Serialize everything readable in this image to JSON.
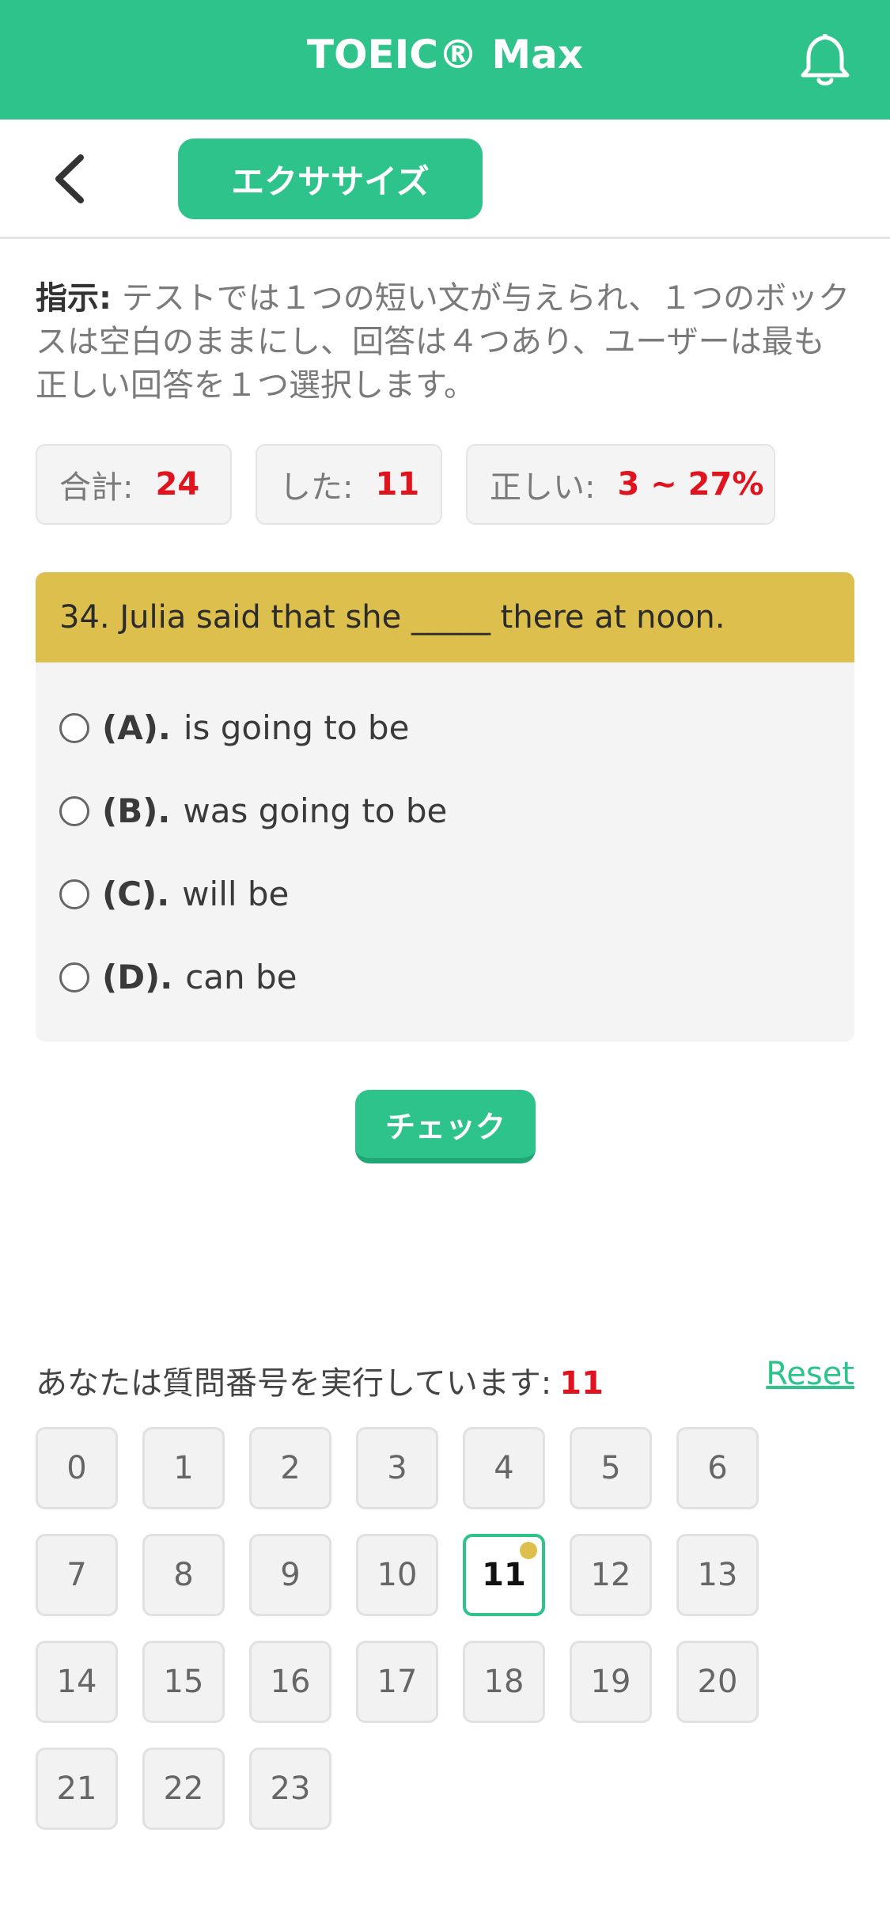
{
  "app": {
    "title": "TOEIC® Max"
  },
  "tab": {
    "label": "エクササイズ"
  },
  "instruction": {
    "label": "指示:",
    "text": " テストでは１つの短い文が与えられ、１つのボックスは空白のままにし、回答は４つあり、ユーザーは最も正しい回答を１つ選択します。"
  },
  "stats": {
    "total_label": "合計:",
    "total_value": "24",
    "done_label": "した:",
    "done_value": "11",
    "correct_label": "正しい:",
    "correct_value": "3 ~ 27%"
  },
  "question": {
    "text": "34. Julia said that she _____ there at noon.",
    "options": [
      {
        "key": "(A).",
        "text": "is going to be"
      },
      {
        "key": "(B).",
        "text": "was going to be"
      },
      {
        "key": "(C).",
        "text": "will be"
      },
      {
        "key": "(D).",
        "text": "can be"
      }
    ]
  },
  "check_button": "チェック",
  "progress": {
    "label": "あなたは質問番号を実行しています:",
    "current": "11",
    "reset": "Reset"
  },
  "question_numbers": [
    "0",
    "1",
    "2",
    "3",
    "4",
    "5",
    "6",
    "7",
    "8",
    "9",
    "10",
    "11",
    "12",
    "13",
    "14",
    "15",
    "16",
    "17",
    "18",
    "19",
    "20",
    "21",
    "22",
    "23"
  ],
  "active_question": "11",
  "icons": {
    "bell": "bell-icon",
    "back": "chevron-left-icon"
  },
  "colors": {
    "primary": "#2ec38a",
    "accent_yellow": "#dcbf4d",
    "highlight_red": "#e0141e"
  }
}
